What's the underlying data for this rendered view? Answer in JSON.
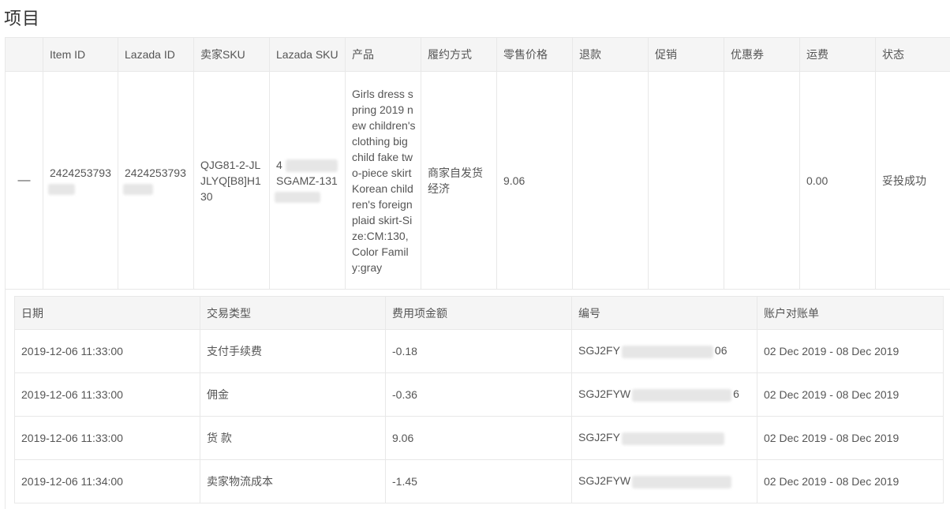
{
  "section_title": "项目",
  "columns": [
    "Item ID",
    "Lazada ID",
    "卖家SKU",
    "Lazada SKU",
    "产品",
    "履约方式",
    "零售价格",
    "退款",
    "促销",
    "优惠券",
    "运费",
    "状态"
  ],
  "item": {
    "expand_toggle": "—",
    "item_id": "2424253793",
    "lazada_id": "2424253793",
    "seller_sku": "QJG81-2-JLJLYQ[B8]H130",
    "lazada_sku_prefix": "4",
    "lazada_sku_line2": "SGAMZ-131",
    "product": "Girls dress spring 2019 new children's clothing big child fake two-piece skirt Korean children's foreign plaid skirt-Size:CM:130, Color Family:gray",
    "fulfillment_line1": "商家自发货",
    "fulfillment_line2": "经济",
    "retail_price": "9.06",
    "refund": "",
    "promotion": "",
    "coupon": "",
    "shipping": "0.00",
    "status": "妥投成功"
  },
  "transactions": {
    "columns": [
      "日期",
      "交易类型",
      "费用项金额",
      "编号",
      "账户对账单"
    ],
    "rows": [
      {
        "date": "2019-12-06 11:33:00",
        "type": "支付手续费",
        "amount": "-0.18",
        "id_prefix": "SGJ2FY",
        "id_suffix": "06",
        "statement": "02 Dec 2019 - 08 Dec 2019"
      },
      {
        "date": "2019-12-06 11:33:00",
        "type": "佣金",
        "amount": "-0.36",
        "id_prefix": "SGJ2FYW",
        "id_suffix": "6",
        "statement": "02 Dec 2019 - 08 Dec 2019"
      },
      {
        "date": "2019-12-06 11:33:00",
        "type": "货 款",
        "amount": "9.06",
        "id_prefix": "SGJ2FY",
        "id_suffix": "",
        "statement": "02 Dec 2019 - 08 Dec 2019"
      },
      {
        "date": "2019-12-06 11:34:00",
        "type": "卖家物流成本",
        "amount": "-1.45",
        "id_prefix": "SGJ2FYW",
        "id_suffix": "",
        "statement": "02 Dec 2019 - 08 Dec 2019"
      }
    ]
  }
}
